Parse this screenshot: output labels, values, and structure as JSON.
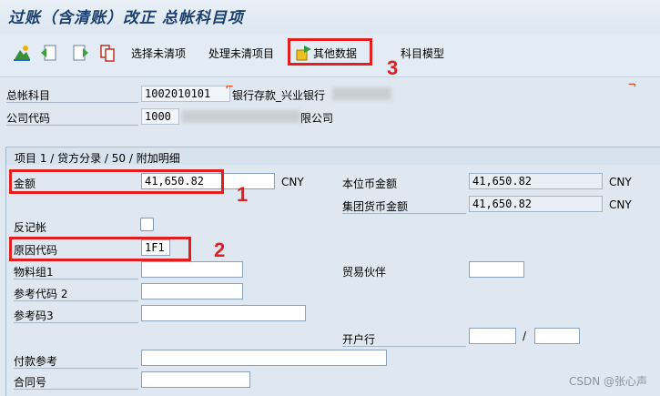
{
  "title": "过账（含清账）改正 总帐科目项",
  "toolbar": {
    "select_open": "选择未清项",
    "process_open": "处理未清项目",
    "other_data": "其他数据",
    "account_model": "科目模型"
  },
  "header": {
    "gl_label": "总帐科目",
    "gl_value": "1002010101",
    "gl_desc": "银行存款_兴业银行",
    "company_label": "公司代码",
    "company_value": "1000",
    "company_desc": "限公司"
  },
  "section": {
    "title": "项目 1 / 贷方分录 / 50 / 附加明细"
  },
  "form": {
    "amount_label": "金额",
    "amount_value": "41,650.82",
    "amount_currency": "CNY",
    "local_amount_label": "本位币金额",
    "local_amount_value": "41,650.82",
    "local_currency": "CNY",
    "group_amount_label": "集团货币金额",
    "group_amount_value": "41,650.82",
    "group_currency": "CNY",
    "reversal_label": "反记帐",
    "reason_label": "原因代码",
    "reason_value": "1F1",
    "material_group_label": "物料组1",
    "trading_partner_label": "贸易伙伴",
    "ref_code2_label": "参考代码 2",
    "ref_code3_label": "参考码3",
    "house_bank_label": "开户行",
    "house_bank_sep": "/",
    "payment_ref_label": "付款参考",
    "contract_label": "合同号"
  },
  "annotations": {
    "one": "1",
    "two": "2",
    "three": "3"
  },
  "watermark": "CSDN @张心声"
}
